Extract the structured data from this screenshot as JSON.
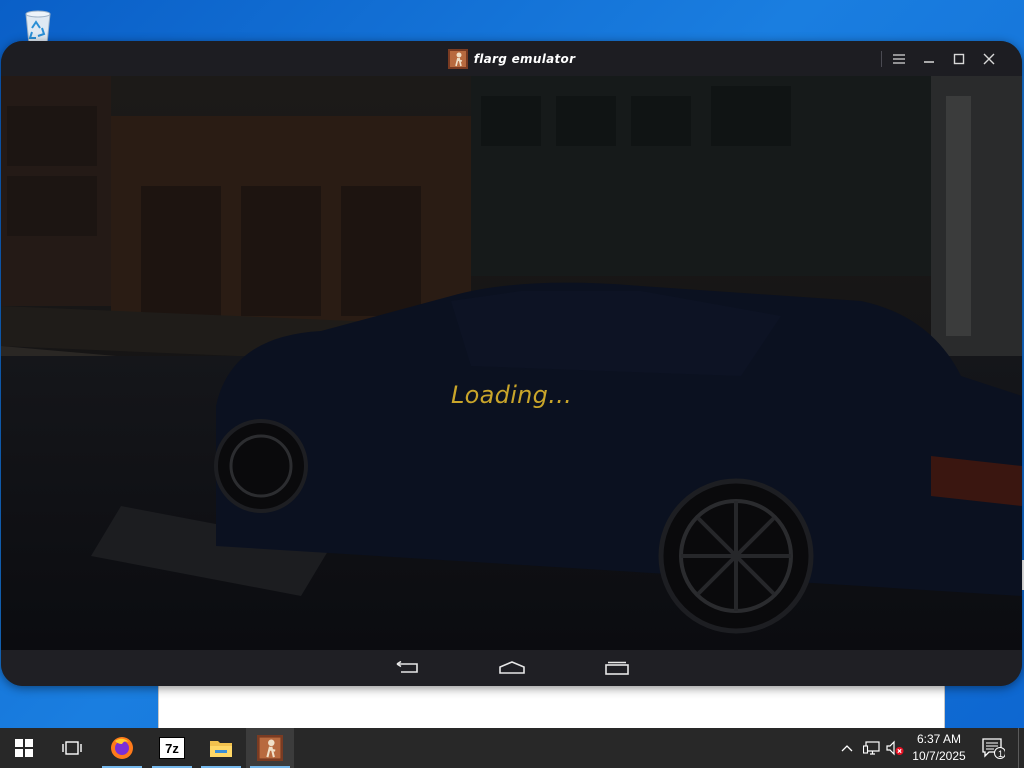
{
  "desktop": {
    "icons": [
      {
        "name": "recycle-bin-icon"
      }
    ]
  },
  "emulator": {
    "title": "flarg emulator",
    "loading_text": "Loading...",
    "window_buttons": [
      "menu-icon",
      "minimize-icon",
      "maximize-icon",
      "close-icon"
    ],
    "nav_buttons": [
      "back-icon",
      "home-icon",
      "recents-icon"
    ]
  },
  "taskbar": {
    "buttons": [
      {
        "name": "start-button",
        "icon": "windows-logo-icon"
      },
      {
        "name": "task-view-button",
        "icon": "task-view-icon"
      },
      {
        "name": "firefox-button",
        "icon": "firefox-icon"
      },
      {
        "name": "7zip-button",
        "icon": "7zip-icon",
        "label": "7z"
      },
      {
        "name": "file-explorer-button",
        "icon": "folder-icon"
      },
      {
        "name": "flarg-emulator-button",
        "icon": "emulator-app-icon"
      }
    ],
    "tray": {
      "icons": [
        "chevron-up-icon",
        "network-icon",
        "volume-muted-icon"
      ],
      "time": "6:37 AM",
      "date": "10/7/2025",
      "notification_count": "1"
    }
  },
  "colors": {
    "loading_text": "#c9a52a",
    "taskbar": "#282828",
    "desktop": "#0a5fc7",
    "emulator_chrome": "#1f1f24"
  }
}
